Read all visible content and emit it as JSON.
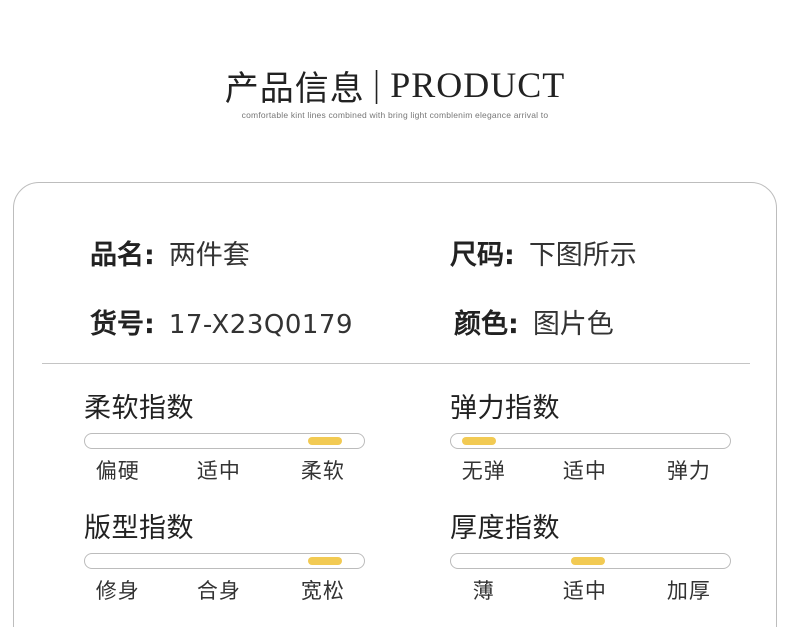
{
  "header": {
    "title_cn": "产品信息",
    "separator": "|",
    "title_en": "PRODUCT",
    "subtitle": "comfortable kint lines combined with bring light comblenim elegance arrival to"
  },
  "info": {
    "name": {
      "label": "品名:",
      "value": "两件套"
    },
    "size": {
      "label": "尺码:",
      "value": "下图所示"
    },
    "sku": {
      "label": "货号:",
      "value": "17-X23Q0179"
    },
    "color": {
      "label": "颜色:",
      "value": "图片色"
    }
  },
  "gauges": {
    "softness": {
      "title": "柔软指数",
      "options": [
        "偏硬",
        "适中",
        "柔软"
      ],
      "level": 0.86
    },
    "elasticity": {
      "title": "弹力指数",
      "options": [
        "无弹",
        "适中",
        "弹力"
      ],
      "level": 0.1
    },
    "fit": {
      "title": "版型指数",
      "options": [
        "修身",
        "合身",
        "宽松"
      ],
      "level": 0.86
    },
    "thickness": {
      "title": "厚度指数",
      "options": [
        "薄",
        "适中",
        "加厚"
      ],
      "level": 0.49
    }
  },
  "colors": {
    "accent": "#f2ca53",
    "border": "#bdbdbd",
    "text": "#2b2b2b"
  }
}
